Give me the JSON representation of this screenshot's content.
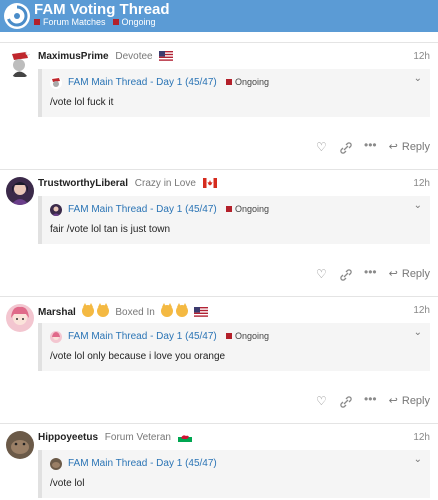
{
  "header": {
    "title": "FAM Voting Thread",
    "crumb_category": "Forum Matches",
    "crumb_tag": "Ongoing"
  },
  "posts": [
    {
      "username": "MaximusPrime",
      "title": "Devotee",
      "flag": "us-flag-icon",
      "time": "12h",
      "quote_link": "FAM Main Thread - Day 1 (45/47)",
      "quote_tag": "Ongoing",
      "body": "/vote lol fuck it"
    },
    {
      "username": "TrustworthyLiberal",
      "title": "Crazy in Love",
      "flag": "canada-flag-icon",
      "time": "12h",
      "quote_link": "FAM Main Thread - Day 1 (45/47)",
      "quote_tag": "Ongoing",
      "body": "fair /vote lol tan is just town"
    },
    {
      "username": "Marshal",
      "title": "Boxed In",
      "flag": "us-flag-icon",
      "time": "12h",
      "quote_link": "FAM Main Thread - Day 1 (45/47)",
      "quote_tag": "Ongoing",
      "body": "/vote lol only because i love you orange"
    },
    {
      "username": "Hippoyeetus",
      "title": "Forum Veteran",
      "flag": "wales-flag-icon",
      "time": "12h",
      "quote_link": "FAM Main Thread - Day 1 (45/47)",
      "quote_tag": "",
      "body": "/vote lol"
    }
  ],
  "actions": {
    "reply_label": "Reply",
    "icons": [
      "heart-icon",
      "link-icon",
      "more-icon",
      "reply-icon"
    ]
  },
  "colors": {
    "header_bg": "#5b9bd5",
    "tag_red": "#b3202a",
    "link_blue": "#2a74b5"
  }
}
